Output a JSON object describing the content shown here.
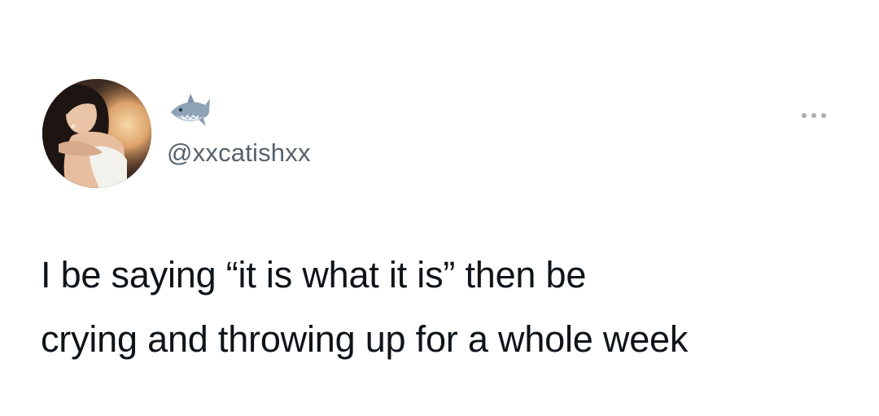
{
  "tweet": {
    "handle": "@xxcatishxx",
    "name_emoji": "shark-emoji",
    "more_icon": "more-options-icon",
    "text_lines": [
      "I be saying “it is what it is” then be",
      "crying and throwing up for a whole week"
    ]
  },
  "colors": {
    "background": "#ffffff",
    "text": "#0f1419",
    "handle": "#57626b",
    "muted_icon": "#a7adb3"
  }
}
